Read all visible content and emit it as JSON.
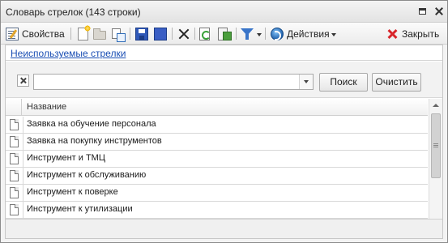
{
  "window": {
    "title": "Словарь стрелок (143 строки)"
  },
  "toolbar": {
    "properties_label": "Свойства",
    "actions_label": "Действия",
    "close_label": "Закрыть"
  },
  "links": {
    "unused_label": "Неиспользуемые стрелки"
  },
  "search": {
    "value": "",
    "placeholder": "",
    "search_button": "Поиск",
    "clear_button": "Очистить"
  },
  "grid": {
    "columns": [
      "Название"
    ],
    "rows": [
      "Заявка на обучение персонала",
      "Заявка на покупку инструментов",
      "Инструмент и ТМЦ",
      "Инструмент к обслуживанию",
      "Инструмент к поверке",
      "Инструмент к утилизации"
    ]
  },
  "colors": {
    "link": "#1b4fb4",
    "close_accent": "#d8262b",
    "save_blue": "#2f58b8"
  },
  "icons": {
    "row": "document-icon"
  }
}
